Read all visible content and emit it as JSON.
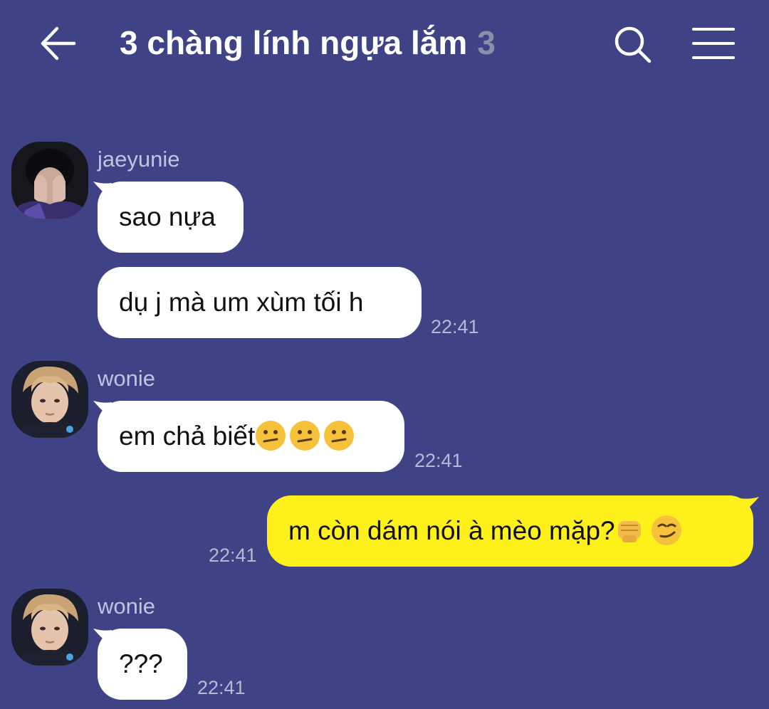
{
  "header": {
    "title": "3 chàng lính ngựa lắm",
    "member_count": "3"
  },
  "messages": [
    {
      "sender": "jaeyunie",
      "text": "sao nựa"
    },
    {
      "text": "dụ j mà um xùm tối h",
      "time": "22:41"
    },
    {
      "sender": "wonie",
      "text": "em chả biết",
      "time": "22:41"
    },
    {
      "text": "m còn dám nói à mèo mặp?",
      "time": "22:41"
    },
    {
      "sender": "wonie",
      "text": "???",
      "time": "22:41"
    }
  ],
  "colors": {
    "background": "#3f4386",
    "incoming_bubble": "#ffffff",
    "outgoing_bubble": "#fef01b",
    "timestamp": "#b6b9d6",
    "sender_name": "#c1c4e0"
  }
}
